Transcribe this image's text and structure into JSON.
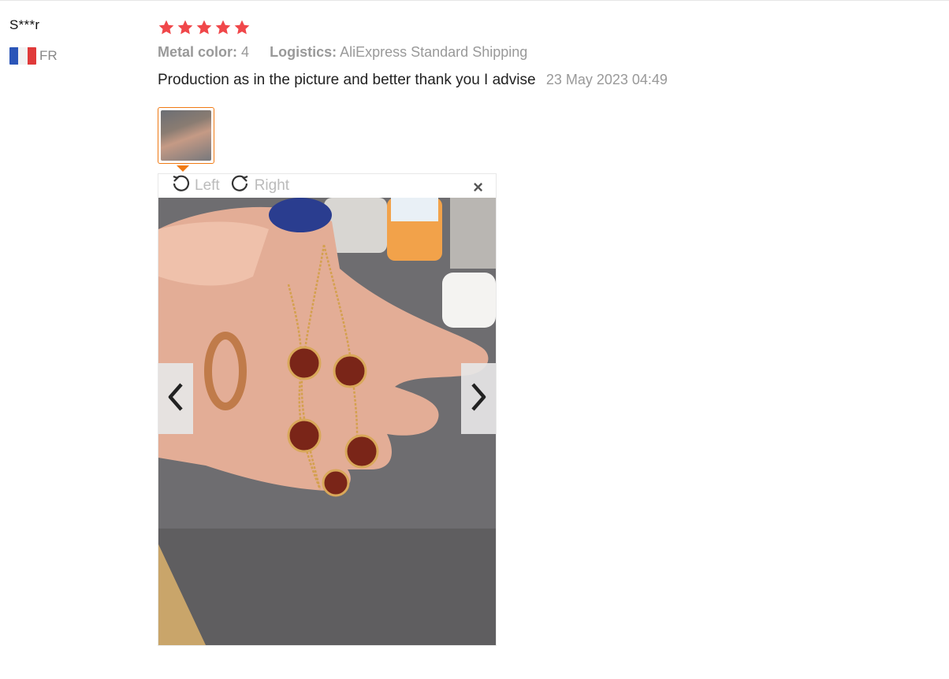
{
  "reviewer": {
    "name": "S***r",
    "country_code": "FR",
    "flag_icon": "france-flag-icon"
  },
  "review": {
    "rating": 5,
    "star_color": "#f0474a",
    "attributes": [
      {
        "label": "Metal color:",
        "value": "4"
      },
      {
        "label": "Logistics:",
        "value": "AliExpress Standard Shipping"
      }
    ],
    "text": "Production as in the picture and better thank you I advise",
    "date": "23 May 2023 04:49"
  },
  "viewer": {
    "rotate_left_label": "Left",
    "rotate_right_label": "Right",
    "close_label": "×",
    "prev_icon": "chevron-left-icon",
    "next_icon": "chevron-right-icon",
    "accent_color": "#f07a14"
  }
}
